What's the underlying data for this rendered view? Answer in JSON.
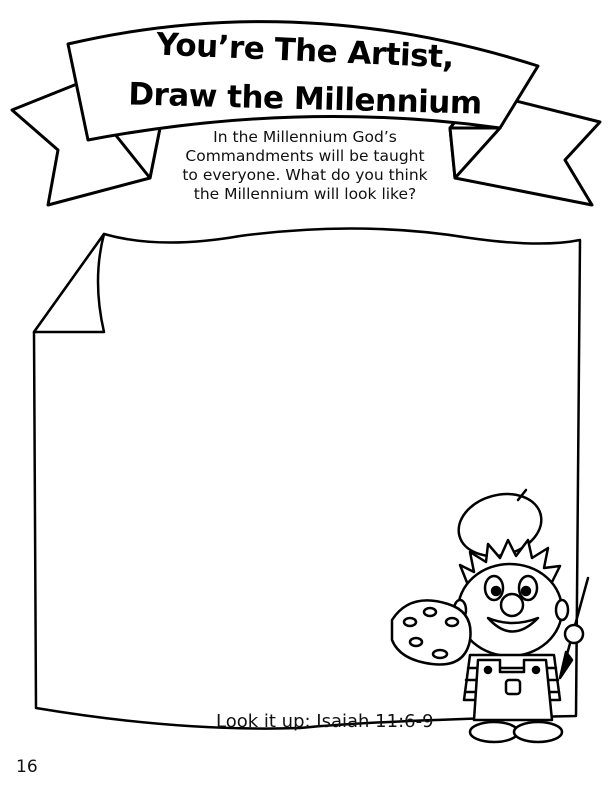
{
  "banner": {
    "title_line1": "You’re The Artist,",
    "title_line2": "Draw the Millennium"
  },
  "intro": {
    "line1": "In the Millennium God’s",
    "line2": "Commandments will be taught",
    "line3": "to everyone. What do you think",
    "line4": "the Millennium will look like?"
  },
  "footer": {
    "lookup": "Look it up: Isaiah 11:6-9",
    "page_number": "16"
  }
}
